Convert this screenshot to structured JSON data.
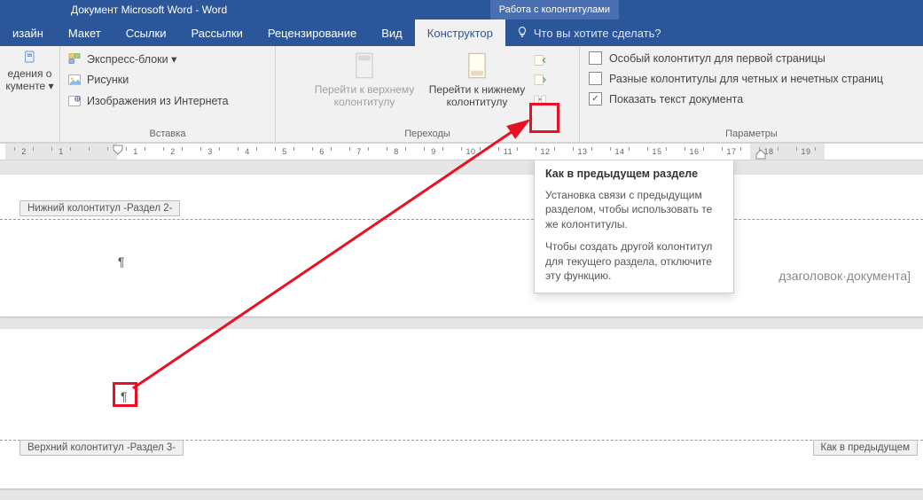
{
  "title": "Документ Microsoft Word - Word",
  "context_tab": "Работа с колонтитулами",
  "tabs": {
    "design_partial": "изайн",
    "layout": "Макет",
    "references": "Ссылки",
    "mailings": "Рассылки",
    "review": "Рецензирование",
    "view": "Вид",
    "designer": "Конструктор",
    "tellme": "Что вы хотите сделать?"
  },
  "groups": {
    "info": {
      "line1": "едения о",
      "line2": "кументе ▾",
      "insert_label": "Вставка",
      "quick_parts": "Экспресс-блоки ▾",
      "pictures": "Рисунки",
      "online_pics": "Изображения из Интернета"
    },
    "nav": {
      "go_prev": "Перейти к верхнему\nколонтитулу",
      "go_next": "Перейти к нижнему\nколонтитулу",
      "label": "Переходы"
    },
    "options": {
      "different_first": "Особый колонтитул для первой страницы",
      "different_odd_even": "Разные колонтитулы для четных и нечетных страниц",
      "show_text": "Показать текст документа",
      "label": "Параметры"
    }
  },
  "tooltip": {
    "title": "Как в предыдущем разделе",
    "body1": "Установка связи с предыдущим разделом, чтобы использовать те же колонтитулы.",
    "body2": "Чтобы создать другой колонтитул для текущего раздела, отключите эту функцию."
  },
  "doc": {
    "footer_tag": "Нижний колонтитул -Раздел 2-",
    "header_tag": "Верхний колонтитул -Раздел 3-",
    "same_as_prev": "Как в предыдущем",
    "doc_subtitle_fragment": "дзаголовок·документа]"
  },
  "ruler_labels": [
    "2",
    "1",
    "",
    "1",
    "2",
    "3",
    "4",
    "5",
    "6",
    "7",
    "8",
    "9",
    "10",
    "11",
    "12",
    "13",
    "14",
    "15",
    "16",
    "17",
    "18",
    "19"
  ]
}
